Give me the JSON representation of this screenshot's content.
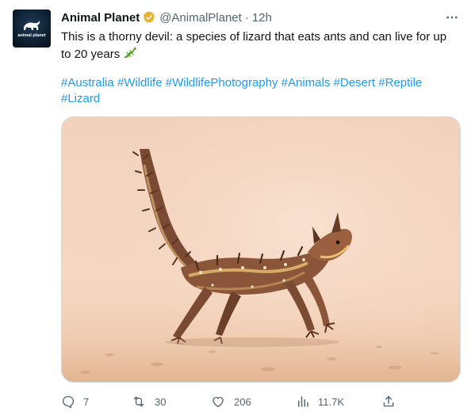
{
  "tweet": {
    "author": {
      "name": "Animal Planet",
      "handle": "@AnimalPlanet",
      "avatar_text": "animal planet",
      "verified_icon": "gold-verified-badge"
    },
    "separator": "·",
    "timestamp": "12h",
    "text": "This is a thorny devil: a species of lizard that eats ants and can live for up to 20 years",
    "text_emoji": "lizard-emoji",
    "hashtags": [
      "#Australia",
      "#Wildlife",
      "#WildlifePhotography",
      "#Animals",
      "#Desert",
      "#Reptile",
      "#Lizard"
    ],
    "media": {
      "description_icon": "thorny-devil-photo"
    },
    "actions": {
      "reply": {
        "icon": "reply-icon",
        "count": "7"
      },
      "retweet": {
        "icon": "retweet-icon",
        "count": "30"
      },
      "like": {
        "icon": "heart-icon",
        "count": "206"
      },
      "views": {
        "icon": "views-icon",
        "count": "11.7K"
      },
      "share": {
        "icon": "share-icon"
      }
    }
  },
  "colors": {
    "link": "#1d9bf0",
    "muted": "#536471",
    "text": "#0f1419",
    "badge": "#e8b130"
  }
}
